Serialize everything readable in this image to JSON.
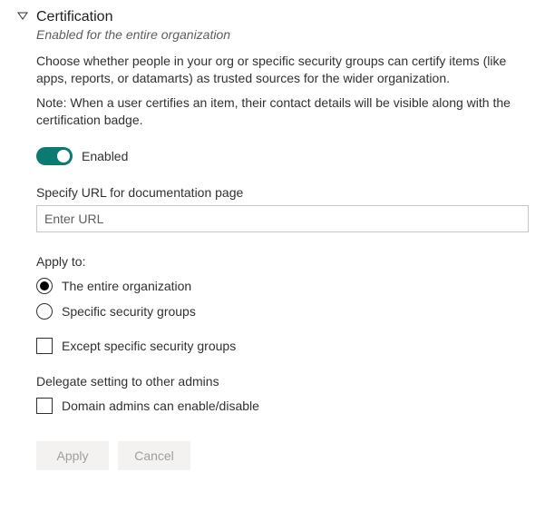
{
  "header": {
    "title": "Certification",
    "subtitle": "Enabled for the entire organization"
  },
  "description": "Choose whether people in your org or specific security groups can certify items (like apps, reports, or datamarts) as trusted sources for the wider organization.",
  "note": "Note: When a user certifies an item, their contact details will be visible along with the certification badge.",
  "toggle": {
    "label": "Enabled"
  },
  "url": {
    "label": "Specify URL for documentation page",
    "placeholder": "Enter URL"
  },
  "applyTo": {
    "label": "Apply to:",
    "optionEntireOrg": "The entire organization",
    "optionSpecificGroups": "Specific security groups"
  },
  "exceptGroups": {
    "label": "Except specific security groups"
  },
  "delegate": {
    "label": "Delegate setting to other admins",
    "domainAdmins": "Domain admins can enable/disable"
  },
  "buttons": {
    "apply": "Apply",
    "cancel": "Cancel"
  }
}
